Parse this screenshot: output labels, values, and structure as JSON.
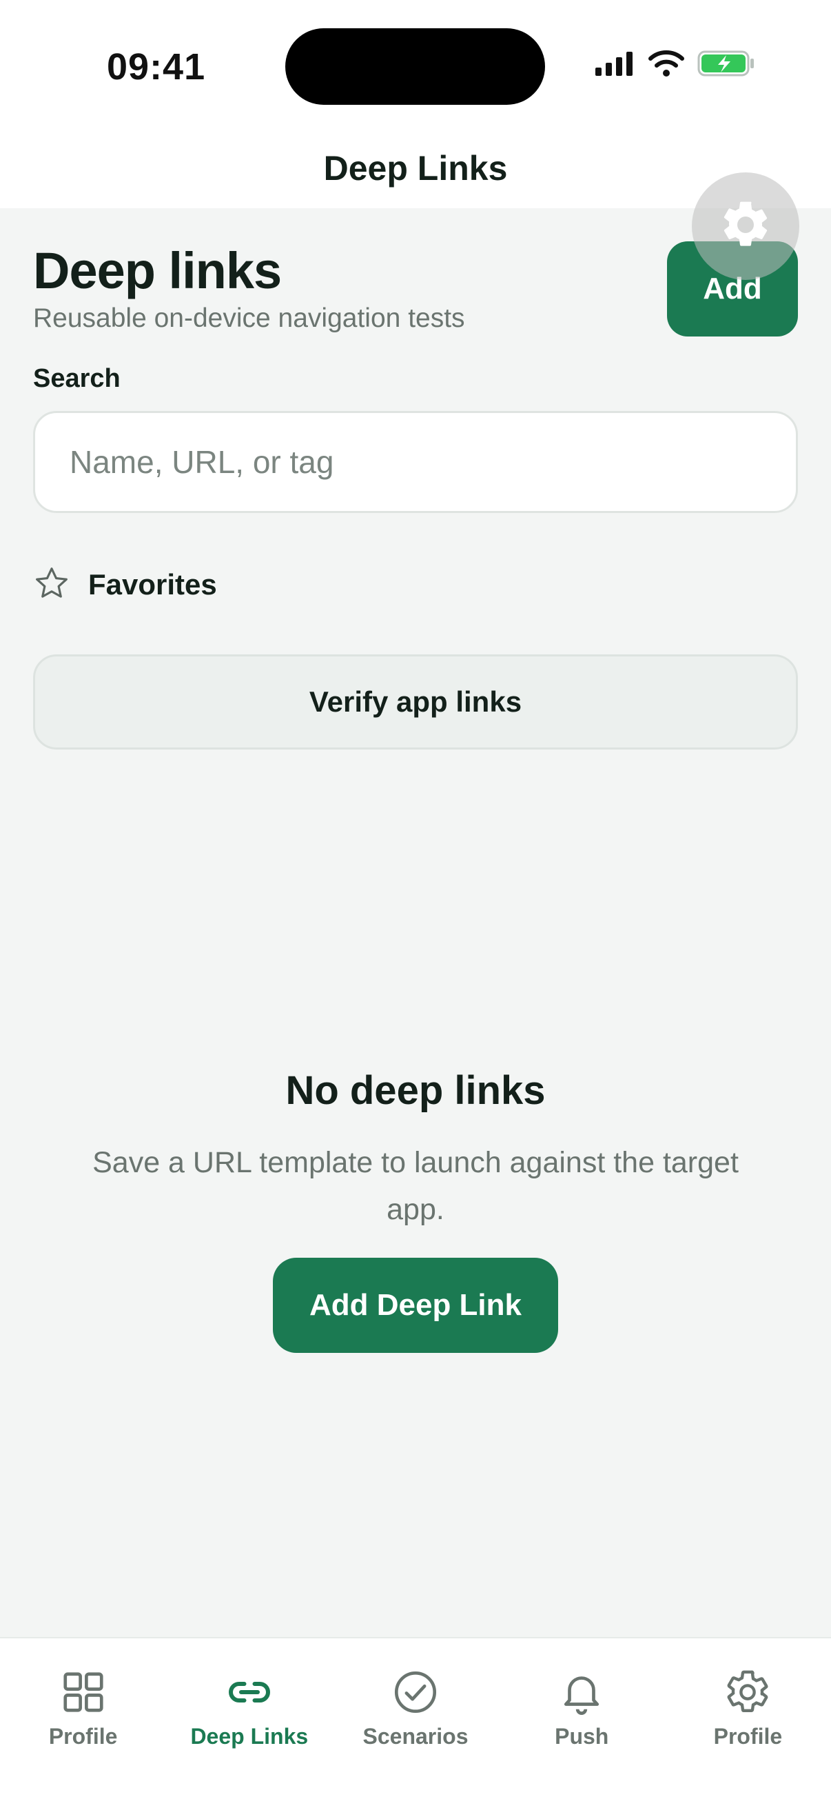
{
  "status_bar": {
    "time": "09:41",
    "icons": [
      "cellular-signal-icon",
      "wifi-icon",
      "battery-charging-icon"
    ],
    "battery_color": "#34c759"
  },
  "nav": {
    "title": "Deep Links"
  },
  "floating": {
    "icon": "gear-icon"
  },
  "header": {
    "title": "Deep links",
    "subtitle": "Reusable on-device navigation tests",
    "add_label": "Add"
  },
  "search": {
    "label": "Search",
    "value": "",
    "placeholder": "Name, URL, or tag"
  },
  "favorites": {
    "icon": "star-outline-icon",
    "label": "Favorites"
  },
  "verify": {
    "label": "Verify app links"
  },
  "empty_state": {
    "title": "No deep links",
    "text": "Save a URL template to launch against the target app.",
    "button_label": "Add Deep Link"
  },
  "tabs": [
    {
      "label": "Profile",
      "icon": "grid-icon",
      "active": false
    },
    {
      "label": "Deep Links",
      "icon": "link-icon",
      "active": true
    },
    {
      "label": "Scenarios",
      "icon": "check-circle-icon",
      "active": false
    },
    {
      "label": "Push",
      "icon": "bell-icon",
      "active": false
    },
    {
      "label": "Profile",
      "icon": "gear-icon",
      "active": false
    }
  ],
  "colors": {
    "accent": "#1b7a52",
    "background": "#f3f5f4",
    "muted_text": "#6a746f"
  }
}
